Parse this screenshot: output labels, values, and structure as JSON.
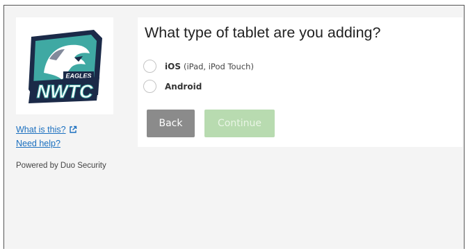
{
  "sidebar": {
    "logo": {
      "icon": "nwtc-eagles-logo",
      "text_eagles": "EAGLES",
      "text_nwtc": "NWTC",
      "colors": {
        "navy": "#1b2a48",
        "teal": "#3fa9a3",
        "white": "#ffffff"
      }
    },
    "what_is_this": "What is this?",
    "need_help": "Need help?",
    "powered_by": "Powered by Duo Security"
  },
  "panel": {
    "title": "What type of tablet are you adding?",
    "options": [
      {
        "label": "iOS",
        "hint": "(iPad, iPod Touch)",
        "selected": false
      },
      {
        "label": "Android",
        "hint": "",
        "selected": false
      }
    ],
    "back_label": "Back",
    "continue_label": "Continue"
  },
  "colors": {
    "background": "#f4f4f4",
    "link": "#1a6fbf",
    "back_button": "#8b8b8b",
    "continue_button_disabled": "#b8dbb0"
  }
}
